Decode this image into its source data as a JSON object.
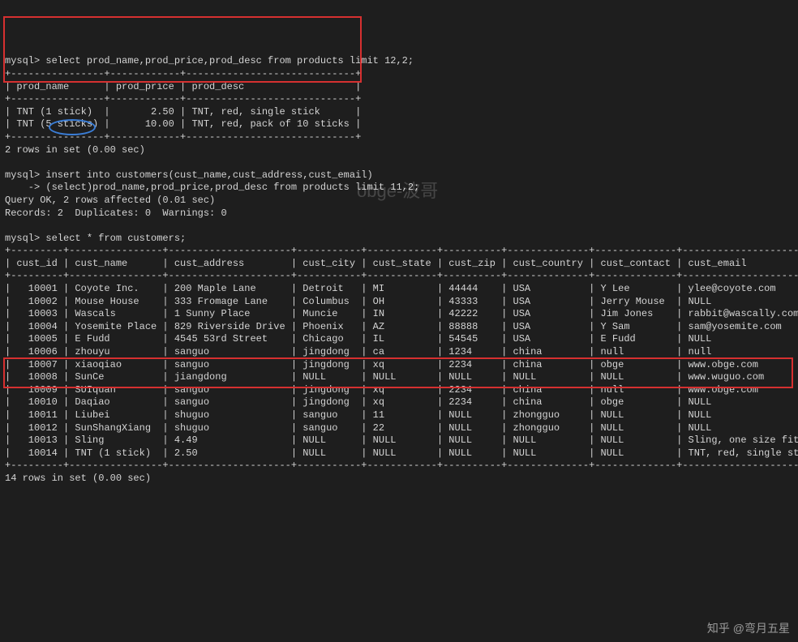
{
  "prompt1": "mysql> select prod_name,prod_price,prod_desc from products limit 12,2;",
  "table1": {
    "sep": "+----------------+------------+-----------------------------+",
    "header": "| prod_name      | prod_price | prod_desc                   |",
    "rows": [
      "| TNT (1 stick)  |       2.50 | TNT, red, single stick      |",
      "| TNT (5 sticks) |      10.00 | TNT, red, pack of 10 sticks |"
    ]
  },
  "status1": "2 rows in set (0.00 sec)",
  "prompt2a": "mysql> insert into customers(cust_name,cust_address,cust_email)",
  "prompt2b": "    -> (select)prod_name,prod_price,prod_desc from products limit 11,2;",
  "status2a": "Query OK, 2 rows affected (0.01 sec)",
  "status2b": "Records: 2  Duplicates: 0  Warnings: 0",
  "prompt3": "mysql> select * from customers;",
  "table2": {
    "sep": "+---------+----------------+---------------------+-----------+------------+----------+--------------+--------------+--------------------------+",
    "header": "| cust_id | cust_name      | cust_address        | cust_city | cust_state | cust_zip | cust_country | cust_contact | cust_email               |",
    "rows": [
      "|   10001 | Coyote Inc.    | 200 Maple Lane      | Detroit   | MI         | 44444    | USA          | Y Lee        | ylee@coyote.com          |",
      "|   10002 | Mouse House    | 333 Fromage Lane    | Columbus  | OH         | 43333    | USA          | Jerry Mouse  | NULL                     |",
      "|   10003 | Wascals        | 1 Sunny Place       | Muncie    | IN         | 42222    | USA          | Jim Jones    | rabbit@wascally.com      |",
      "|   10004 | Yosemite Place | 829 Riverside Drive | Phoenix   | AZ         | 88888    | USA          | Y Sam        | sam@yosemite.com         |",
      "|   10005 | E Fudd         | 4545 53rd Street    | Chicago   | IL         | 54545    | USA          | E Fudd       | NULL                     |",
      "|   10006 | zhouyu         | sanguo              | jingdong  | ca         | 1234     | china        | null         | null                     |",
      "|   10007 | xiaoqiao       | sanguo              | jingdong  | xq         | 2234     | china        | obge         | www.obge.com             |",
      "|   10008 | SunCe          | jiangdong           | NULL      | NULL       | NULL     | NULL         | NULL         | www.wuguo.com            |",
      "|   10009 | SUIquan        | sanguo              | jingdong  | xq         | 2234     | china        | null         | www.obge.com             |",
      "|   10010 | Daqiao         | sanguo              | jingdong  | xq         | 2234     | china        | obge         | NULL                     |",
      "|   10011 | Liubei         | shuguo              | sanguo    | 11         | NULL     | zhongguo     | NULL         | NULL                     |",
      "|   10012 | SunShangXiang  | shuguo              | sanguo    | 22         | NULL     | zhongguo     | NULL         | NULL                     |",
      "|   10013 | Sling          | 4.49                | NULL      | NULL       | NULL     | NULL         | NULL         | Sling, one size fits all |",
      "|   10014 | TNT (1 stick)  | 2.50                | NULL      | NULL       | NULL     | NULL         | NULL         | TNT, red, single stick   |"
    ]
  },
  "status3": "14 rows in set (0.00 sec)",
  "watermark": "obge-波哥",
  "attrib": "知乎 @弯月五星",
  "chart_data": {
    "type": "table",
    "tables": [
      {
        "name": "products_limit_12_2",
        "columns": [
          "prod_name",
          "prod_price",
          "prod_desc"
        ],
        "rows": [
          [
            "TNT (1 stick)",
            2.5,
            "TNT, red, single stick"
          ],
          [
            "TNT (5 sticks)",
            10.0,
            "TNT, red, pack of 10 sticks"
          ]
        ]
      },
      {
        "name": "customers",
        "columns": [
          "cust_id",
          "cust_name",
          "cust_address",
          "cust_city",
          "cust_state",
          "cust_zip",
          "cust_country",
          "cust_contact",
          "cust_email"
        ],
        "rows": [
          [
            10001,
            "Coyote Inc.",
            "200 Maple Lane",
            "Detroit",
            "MI",
            "44444",
            "USA",
            "Y Lee",
            "ylee@coyote.com"
          ],
          [
            10002,
            "Mouse House",
            "333 Fromage Lane",
            "Columbus",
            "OH",
            "43333",
            "USA",
            "Jerry Mouse",
            null
          ],
          [
            10003,
            "Wascals",
            "1 Sunny Place",
            "Muncie",
            "IN",
            "42222",
            "USA",
            "Jim Jones",
            "rabbit@wascally.com"
          ],
          [
            10004,
            "Yosemite Place",
            "829 Riverside Drive",
            "Phoenix",
            "AZ",
            "88888",
            "USA",
            "Y Sam",
            "sam@yosemite.com"
          ],
          [
            10005,
            "E Fudd",
            "4545 53rd Street",
            "Chicago",
            "IL",
            "54545",
            "USA",
            "E Fudd",
            null
          ],
          [
            10006,
            "zhouyu",
            "sanguo",
            "jingdong",
            "ca",
            "1234",
            "china",
            "null",
            "null"
          ],
          [
            10007,
            "xiaoqiao",
            "sanguo",
            "jingdong",
            "xq",
            "2234",
            "china",
            "obge",
            "www.obge.com"
          ],
          [
            10008,
            "SunCe",
            "jiangdong",
            null,
            null,
            null,
            null,
            null,
            "www.wuguo.com"
          ],
          [
            10009,
            "SUIquan",
            "sanguo",
            "jingdong",
            "xq",
            "2234",
            "china",
            "null",
            "www.obge.com"
          ],
          [
            10010,
            "Daqiao",
            "sanguo",
            "jingdong",
            "xq",
            "2234",
            "china",
            "obge",
            null
          ],
          [
            10011,
            "Liubei",
            "shuguo",
            "sanguo",
            "11",
            null,
            "zhongguo",
            null,
            null
          ],
          [
            10012,
            "SunShangXiang",
            "shuguo",
            "sanguo",
            "22",
            null,
            "zhongguo",
            null,
            null
          ],
          [
            10013,
            "Sling",
            "4.49",
            null,
            null,
            null,
            null,
            null,
            "Sling, one size fits all"
          ],
          [
            10014,
            "TNT (1 stick)",
            "2.50",
            null,
            null,
            null,
            null,
            null,
            "TNT, red, single stick"
          ]
        ]
      }
    ]
  }
}
